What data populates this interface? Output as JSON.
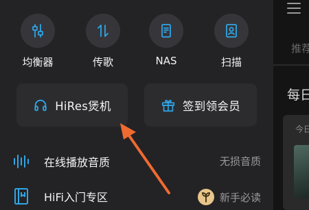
{
  "quick_actions": [
    {
      "label": "均衡器",
      "icon": "equalizer-icon"
    },
    {
      "label": "传歌",
      "icon": "transfer-icon"
    },
    {
      "label": "NAS",
      "icon": "nas-icon"
    },
    {
      "label": "扫描",
      "icon": "scan-icon"
    }
  ],
  "cards": {
    "hires": {
      "label": "HiRes煲机",
      "icon": "headphones-icon"
    },
    "signin": {
      "label": "签到领会员",
      "icon": "gift-icon"
    }
  },
  "list": {
    "quality": {
      "label": "在线播放音质",
      "value": "无损音质",
      "icon": "waveform-icon"
    },
    "hifi": {
      "label": "HiFi入门专区",
      "value": "新手必读",
      "icon": "book-icon",
      "badge_icon": "sprout-icon"
    }
  },
  "side_panel": {
    "tab_partial": "推荐",
    "title_partial": "每日",
    "card_text_partial": "今日"
  },
  "colors": {
    "accent_blue": "#2fa6e8",
    "arrow_orange": "#ef6a31",
    "badge_gold": "#e8c58a"
  }
}
